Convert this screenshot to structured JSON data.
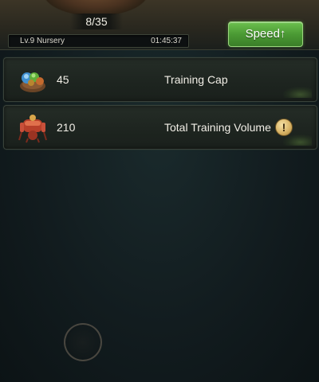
{
  "header": {
    "count": "8/35",
    "level_label": "Lv.9 Nursery",
    "timer": "01:45:37",
    "speed_button": "Speed↑"
  },
  "stats": [
    {
      "value": "45",
      "label": "Training Cap",
      "icon": "nest-food-icon"
    },
    {
      "value": "210",
      "label": "Total Training Volume",
      "icon": "red-ant-icon",
      "info": "!"
    }
  ],
  "colors": {
    "speed_button": "#4b9a34",
    "row_background": "#1d241f",
    "info_badge": "#d8b466"
  }
}
